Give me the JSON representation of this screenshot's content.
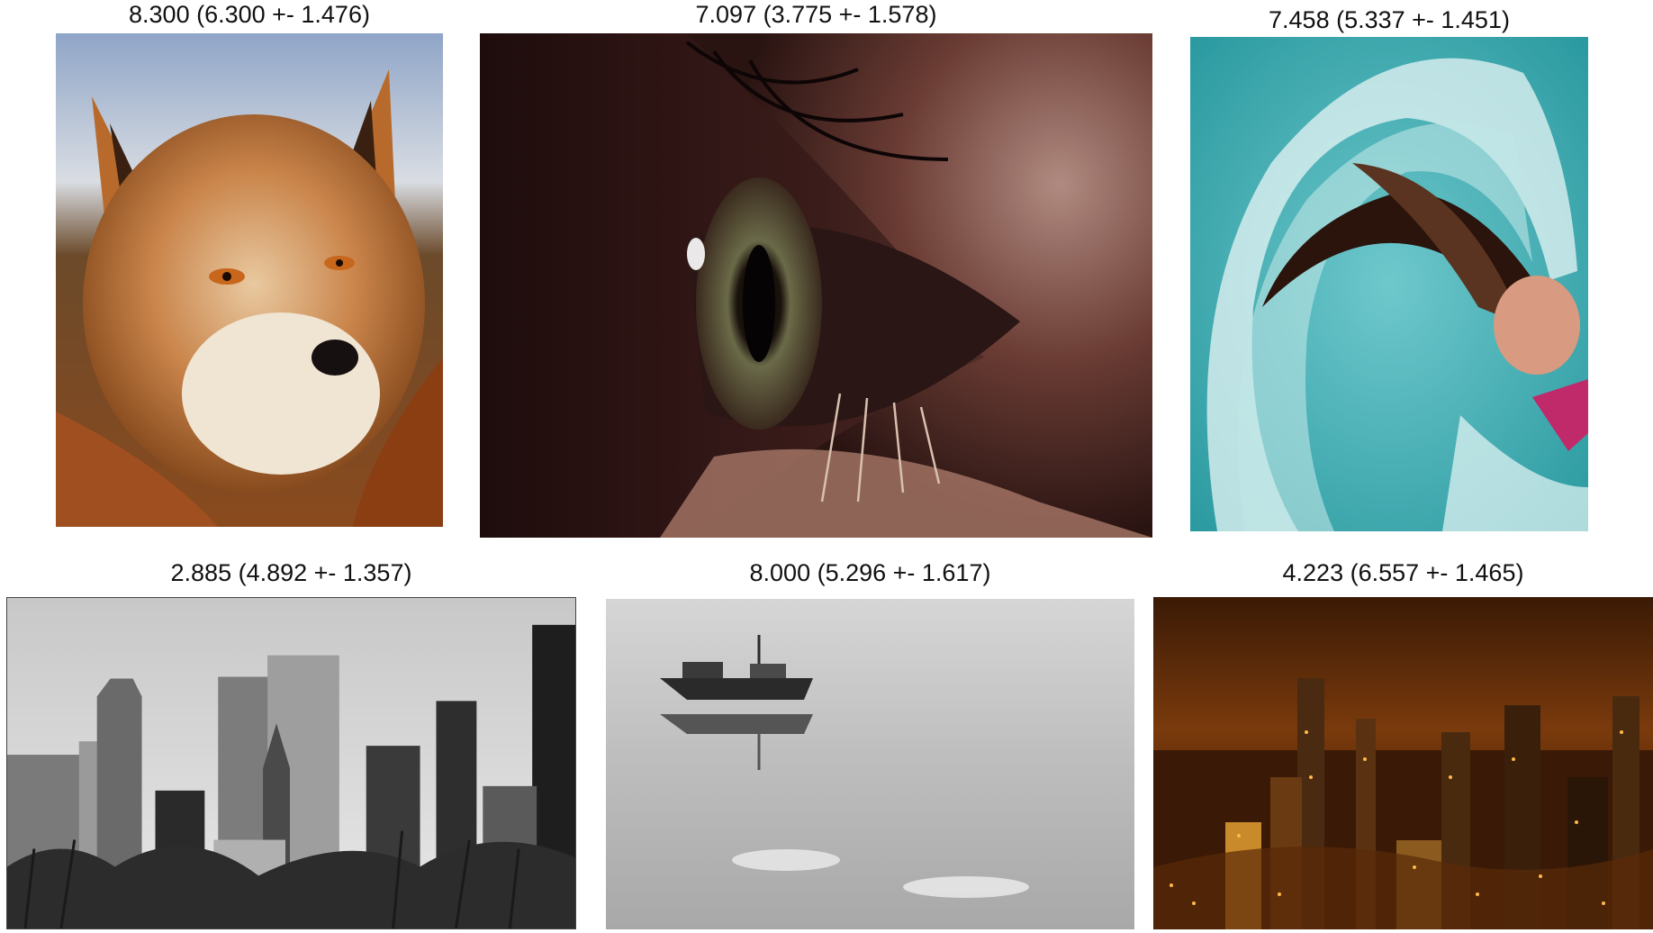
{
  "images": [
    {
      "caption": "8.300 (6.300 +- 1.476)",
      "subject": "fox-photo"
    },
    {
      "caption": "7.097 (3.775 +- 1.578)",
      "subject": "eye-photo"
    },
    {
      "caption": "7.458 (5.337 +- 1.451)",
      "subject": "hair-flip-water-photo"
    },
    {
      "caption": "2.885 (4.892 +- 1.357)",
      "subject": "city-skyline-photo"
    },
    {
      "caption": "8.000 (5.296 +- 1.617)",
      "subject": "boat-reflection-photo"
    },
    {
      "caption": "4.223 (6.557 +- 1.465)",
      "subject": "night-city-photo"
    }
  ]
}
